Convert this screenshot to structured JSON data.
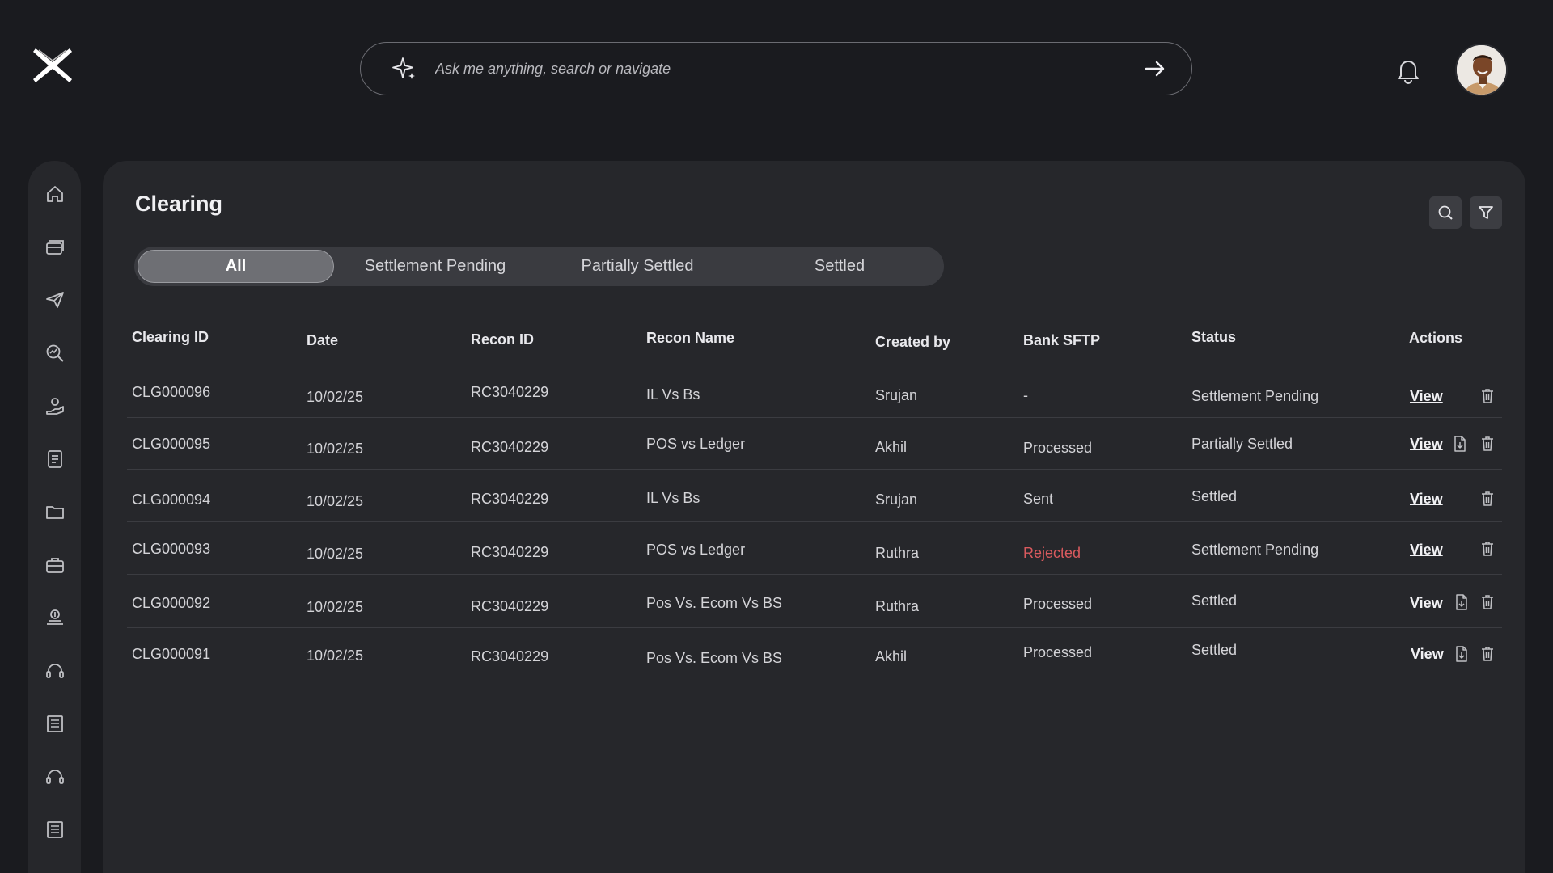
{
  "brand": {
    "logo_icon": "x-logo-icon"
  },
  "search": {
    "placeholder": "Ask me anything, search or navigate",
    "icon": "sparkle-icon",
    "submit_icon": "arrow-right-icon"
  },
  "header": {
    "notification_icon": "bell-icon",
    "avatar_icon": "user-avatar"
  },
  "sidebar": {
    "items": [
      {
        "icon": "home-icon"
      },
      {
        "icon": "cards-icon"
      },
      {
        "icon": "send-icon"
      },
      {
        "icon": "search-analytics-icon"
      },
      {
        "icon": "money-hand-icon"
      },
      {
        "icon": "report-icon"
      },
      {
        "icon": "folder-icon"
      },
      {
        "icon": "briefcase-icon"
      },
      {
        "icon": "finance-icon"
      },
      {
        "icon": "headset-icon"
      },
      {
        "icon": "ledger-icon"
      },
      {
        "icon": "support-icon"
      },
      {
        "icon": "ledger-2-icon"
      }
    ]
  },
  "page": {
    "title": "Clearing"
  },
  "toolbar": {
    "search_icon": "search-icon",
    "filter_icon": "filter-icon"
  },
  "tabs": [
    {
      "label": "All",
      "active": true
    },
    {
      "label": "Settlement Pending",
      "active": false
    },
    {
      "label": "Partially Settled",
      "active": false
    },
    {
      "label": "Settled",
      "active": false
    }
  ],
  "table": {
    "columns": [
      "Clearing ID",
      "Date",
      "Recon ID",
      "Recon Name",
      "Created by",
      "Bank SFTP",
      "Status",
      "Actions"
    ],
    "rows": [
      {
        "clearing_id": "CLG000096",
        "date": "10/02/25",
        "recon_id": "RC3040229",
        "recon_name": "IL Vs Bs",
        "created_by": "Srujan",
        "bank_sftp": "-",
        "status": "Settlement Pending",
        "action": "View",
        "has_file": false
      },
      {
        "clearing_id": "CLG000095",
        "date": "10/02/25",
        "recon_id": "RC3040229",
        "recon_name": "POS vs Ledger",
        "created_by": "Akhil",
        "bank_sftp": "Processed",
        "status": "Partially Settled",
        "action": "View",
        "has_file": true
      },
      {
        "clearing_id": "CLG000094",
        "date": "10/02/25",
        "recon_id": "RC3040229",
        "recon_name": "IL Vs Bs",
        "created_by": "Srujan",
        "bank_sftp": "Sent",
        "status": "Settled",
        "action": "View",
        "has_file": false
      },
      {
        "clearing_id": "CLG000093",
        "date": "10/02/25",
        "recon_id": "RC3040229",
        "recon_name": "POS vs Ledger",
        "created_by": "Ruthra",
        "bank_sftp": "Rejected",
        "status": "Settlement Pending",
        "action": "View",
        "has_file": false
      },
      {
        "clearing_id": "CLG000092",
        "date": "10/02/25",
        "recon_id": "RC3040229",
        "recon_name": "Pos Vs. Ecom Vs BS",
        "created_by": "Ruthra",
        "bank_sftp": "Processed",
        "status": "Settled",
        "action": "View",
        "has_file": true
      },
      {
        "clearing_id": "CLG000091",
        "date": "10/02/25",
        "recon_id": "RC3040229",
        "recon_name": "Pos Vs. Ecom Vs BS",
        "created_by": "Akhil",
        "bank_sftp": "Processed",
        "status": "Settled",
        "action": "View",
        "has_file": true
      }
    ]
  },
  "colors": {
    "background": "#1a1b1f",
    "panel": "#26272b",
    "rejected": "#d95a5e"
  }
}
